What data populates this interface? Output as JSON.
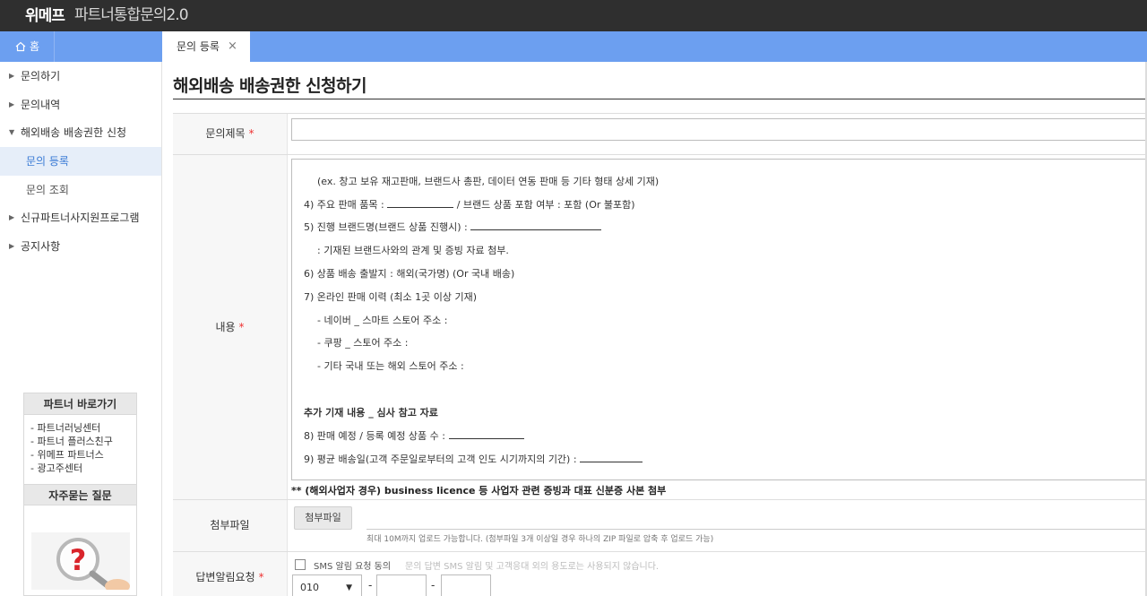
{
  "header": {
    "brand": "위메프",
    "brand_sub": "파트너통합문의2.0"
  },
  "tabs": {
    "home": "홈",
    "active": "문의 등록",
    "close": "×"
  },
  "sidebar": {
    "items": [
      {
        "label": "문의하기"
      },
      {
        "label": "문의내역"
      },
      {
        "label": "해외배송 배송권한 신청"
      },
      {
        "label": "신규파트너사지원프로그램"
      },
      {
        "label": "공지사항"
      }
    ],
    "sub_items": [
      {
        "label": "문의 등록"
      },
      {
        "label": "문의 조회"
      }
    ]
  },
  "partner_box": {
    "title": "파트너 바로가기",
    "links": [
      "- 파트너러닝센터",
      "- 파트너 플러스친구",
      "- 위메프 파트너스",
      "- 광고주센터"
    ],
    "faq_title": "자주묻는 질문"
  },
  "page": {
    "title": "해외배송 배송권한 신청하기"
  },
  "form": {
    "title_label": "문의제목",
    "content_label": "내용",
    "required_mark": "*",
    "editor_lines": {
      "l1": "(ex. 창고 보유 재고판매, 브랜드사 총판, 데이터 연동 판매 등 기타 형태 상세 기재)",
      "l2a": "4) 주요 판매 품목 : ",
      "l2b": " / 브랜드 상품 포함 여부 : 포함 (Or 불포함)",
      "l3": "5) 진행 브랜드명(브랜드 상품 진행시) : ",
      "l4": ": 기재된 브랜드사와의 관계 및 증빙 자료 첨부.",
      "l5": "6) 상품 배송 출발지 : 해외(국가명) (Or 국내 배송)",
      "l6": "7) 온라인 판매 이력 (최소 1곳 이상 기재)",
      "l7": "- 네이버 _ 스마트 스토어 주소 :",
      "l8": "- 쿠팡 _ 스토어 주소 :",
      "l9": "- 기타 국내 또는 해외 스토어 주소 :",
      "l10": "추가 기재 내용 _ 심사 참고 자료",
      "l11": "8) 판매 예정 / 등록 예정 상품 수 : ",
      "l12": "9) 평균 배송일(고객 주문일로부터의 고객 인도 시기까지의 기간) : "
    },
    "notice": "** (해외사업자 경우) business licence 등 사업자 관련 증빙과 대표 신분증 사본 첨부",
    "file_label": "첨부파일",
    "file_button": "첨부파일",
    "file_hint": "최대 10M까지 업로드 가능합니다. (첨부파일 3개 이상일 경우 하나의 ZIP 파일로 압축 후 업로드 가능)",
    "sms_label_row": "답변알림요청",
    "sms_check_label": "SMS 알림 요청 동의",
    "sms_note": "문의 답변 SMS 알림 및 고객응대 외의 용도로는 사용되지 않습니다.",
    "phone_prefix": "010",
    "phone_dash": "-"
  }
}
